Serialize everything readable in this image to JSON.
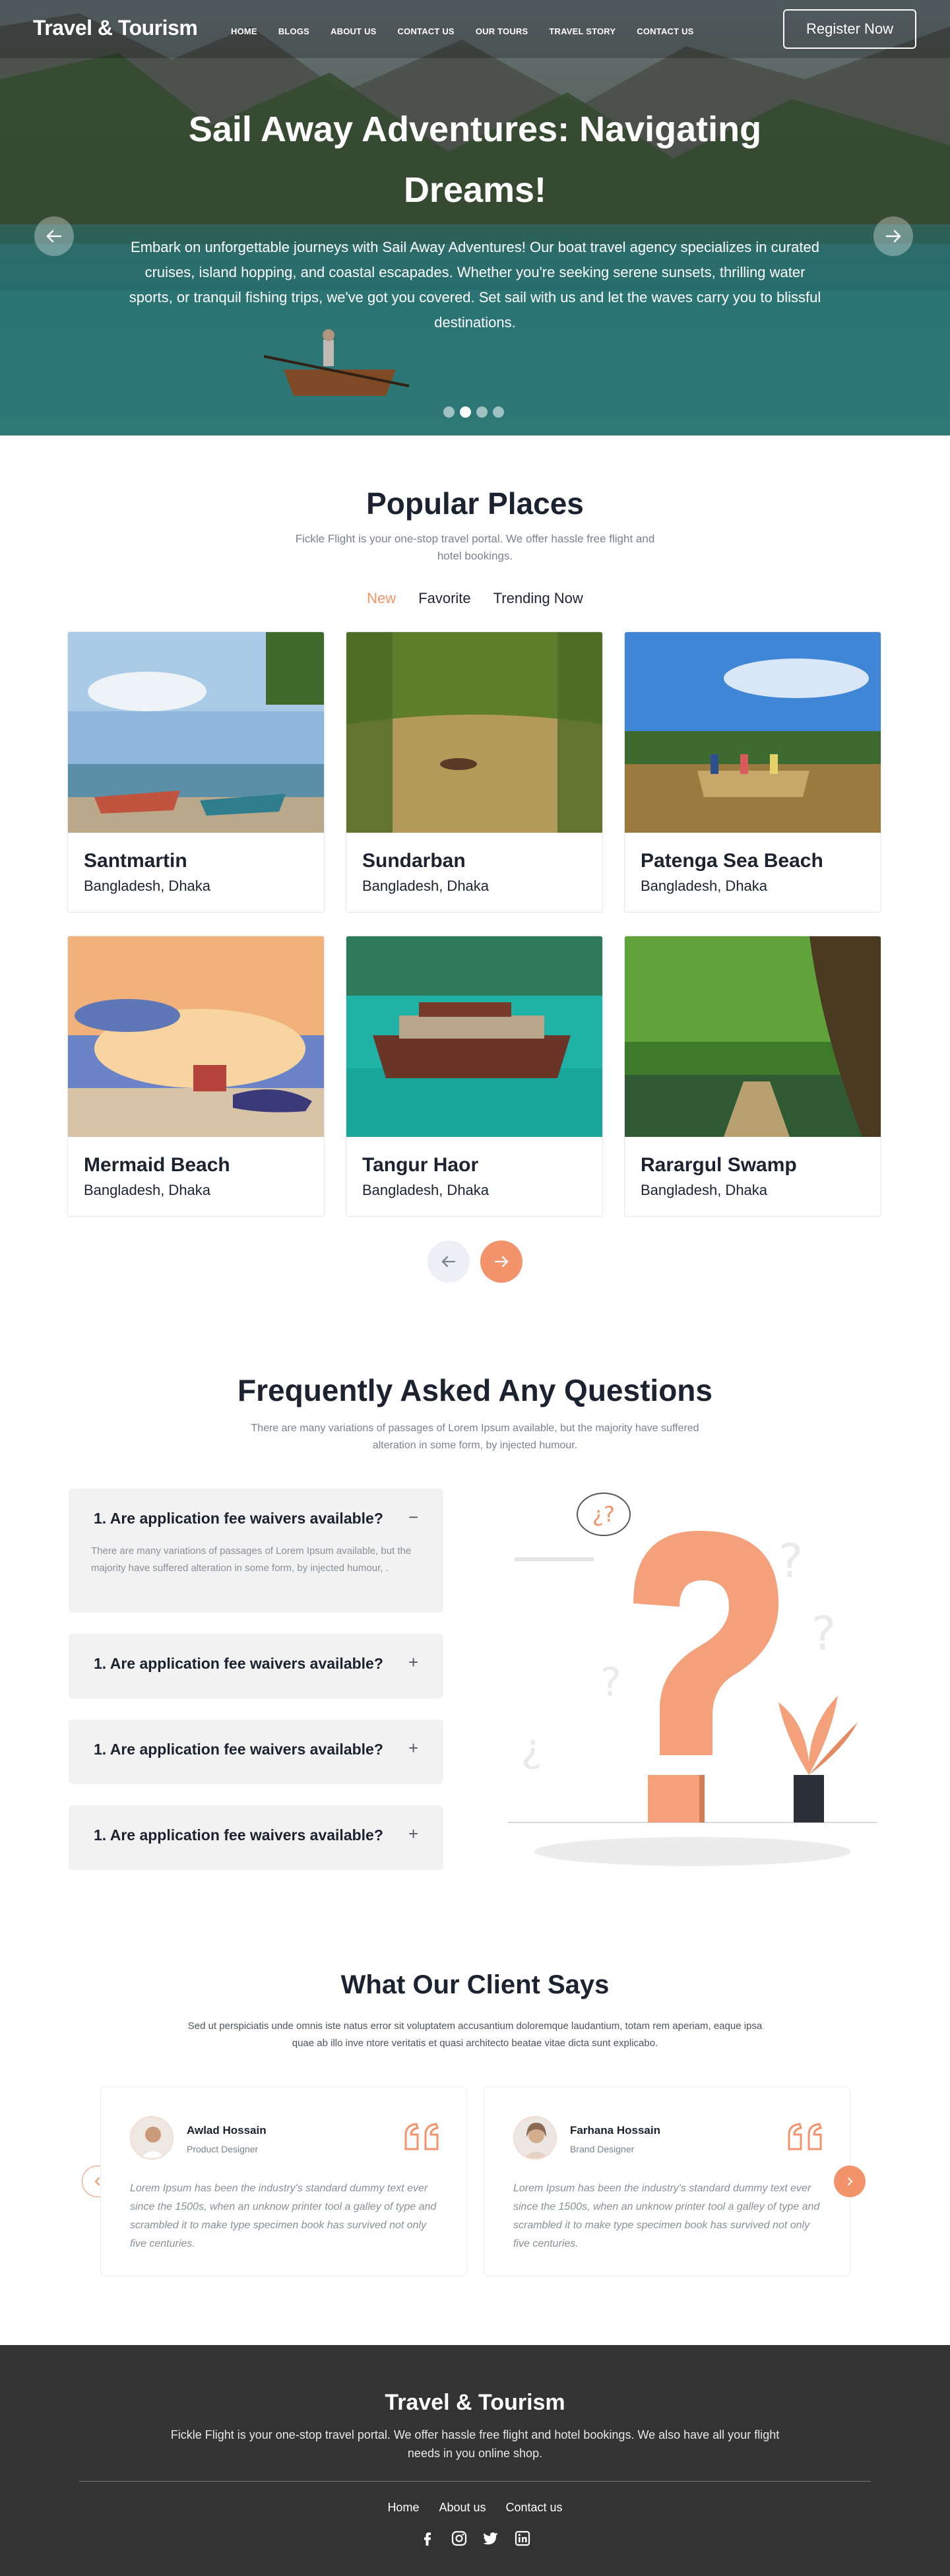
{
  "header": {
    "logo": "Travel & Tourism",
    "nav": [
      "HOME",
      "BLOGS",
      "ABOUT US",
      "CONTACT US",
      "OUR TOURS",
      "TRAVEL STORY",
      "CONTACT US"
    ],
    "register_label": "Register Now"
  },
  "hero": {
    "title": "Sail Away Adventures: Navigating Dreams!",
    "text": "Embark on unforgettable journeys with Sail Away Adventures! Our boat travel agency specializes in curated cruises, island hopping, and coastal escapades. Whether you're seeking serene sunsets, thrilling water sports, or tranquil fishing trips, we've got you covered. Set sail with us and let the waves carry you to blissful destinations.",
    "slide_count": 4,
    "active_slide": 2
  },
  "popular": {
    "title": "Popular Places",
    "subtitle": "Fickle Flight is your one-stop travel portal. We offer hassle free flight and hotel bookings.",
    "tabs": [
      "New",
      "Favorite",
      "Trending Now"
    ],
    "active_tab": "New",
    "places": [
      {
        "name": "Santmartin",
        "location": "Bangladesh, Dhaka"
      },
      {
        "name": "Sundarban",
        "location": "Bangladesh, Dhaka"
      },
      {
        "name": "Patenga Sea Beach",
        "location": "Bangladesh, Dhaka"
      },
      {
        "name": "Mermaid Beach",
        "location": "Bangladesh, Dhaka"
      },
      {
        "name": "Tangur Haor",
        "location": "Bangladesh, Dhaka"
      },
      {
        "name": "Rarargul Swamp",
        "location": "Bangladesh, Dhaka"
      }
    ]
  },
  "faq": {
    "title": "Frequently Asked Any Questions",
    "subtitle": "There are many variations of passages of Lorem Ipsum available, but the majority have suffered alteration in some form, by injected humour.",
    "items": [
      {
        "question": "1.  Are application fee waivers available?",
        "answer": "There are many variations of passages of Lorem Ipsum available, but the majority have suffered alteration in some form, by injected humour, .",
        "open": true,
        "toggle": "−"
      },
      {
        "question": "1.  Are application fee waivers available?",
        "open": false,
        "toggle": "+"
      },
      {
        "question": "1.  Are application fee waivers available?",
        "open": false,
        "toggle": "+"
      },
      {
        "question": "1.  Are application fee waivers available?",
        "open": false,
        "toggle": "+"
      }
    ],
    "bubble": "¿?"
  },
  "testimonials": {
    "title": "What Our Client Says",
    "subtitle": "Sed ut perspiciatis unde omnis iste natus error sit voluptatem accusantium doloremque laudantium, totam rem aperiam, eaque ipsa quae ab illo inve ntore veritatis et quasi architecto beatae vitae dicta sunt explicabo.",
    "items": [
      {
        "name": "Awlad Hossain",
        "role": "Product Designer",
        "text": "Lorem Ipsum has been the industry's standard dummy text ever since the 1500s, when an unknow printer tool a galley of type and scrambled it to make type specimen book has survived not only five centuries."
      },
      {
        "name": "Farhana Hossain",
        "role": "Brand Designer",
        "text": "Lorem Ipsum has been the industry's standard dummy text ever since the 1500s, when an unknow printer tool a galley of type and scrambled it to make type specimen book has survived not only five centuries."
      }
    ]
  },
  "footer": {
    "title": "Travel & Tourism",
    "text": "Fickle Flight is your one-stop travel portal. We offer hassle free flight and hotel bookings. We also have all your flight needs in you online shop.",
    "links": [
      "Home",
      "About us",
      "Contact us"
    ],
    "social": [
      "facebook-icon",
      "instagram-icon",
      "twitter-icon",
      "linkedin-icon"
    ]
  },
  "colors": {
    "accent": "#f3936b",
    "dark": "#1b2230",
    "footer_bg": "#333333"
  }
}
